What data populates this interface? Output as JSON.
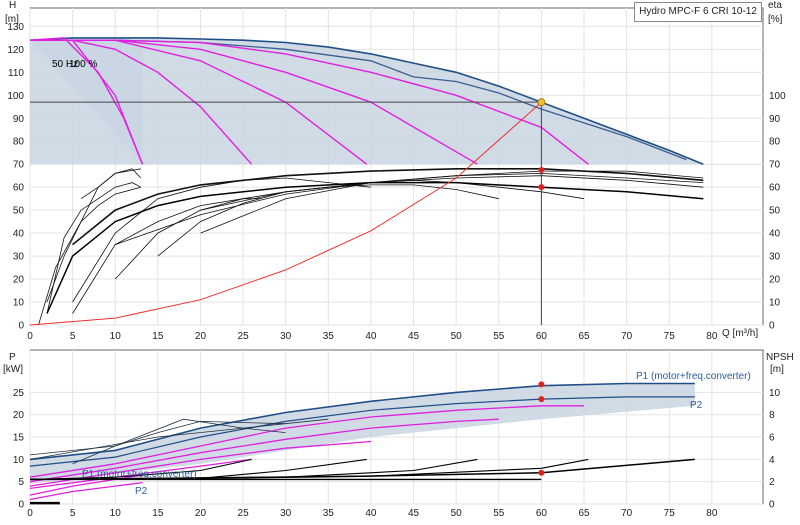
{
  "title": "Hydro MPC-F 6 CRI 10-12",
  "top_chart": {
    "ylabel_left": "H",
    "ylabel_left_unit": "[m]",
    "ylabel_right": "eta",
    "ylabel_right_unit": "[%]",
    "xlabel": "Q [m³/h]",
    "x_ticks": [
      0,
      5,
      10,
      15,
      20,
      25,
      30,
      35,
      40,
      45,
      50,
      55,
      60,
      65,
      70,
      75,
      80
    ],
    "y_left_ticks": [
      0,
      10,
      20,
      30,
      40,
      50,
      60,
      70,
      80,
      90,
      100,
      110,
      120,
      130
    ],
    "y_right_ticks": [
      0,
      10,
      20,
      30,
      40,
      50,
      60,
      70,
      80,
      90,
      100
    ],
    "annot_freq": "50 Hz",
    "annot_pct": "100 %",
    "duty_q": 60,
    "duty_h": 97
  },
  "bottom_chart": {
    "ylabel_left": "P",
    "ylabel_left_unit": "[kW]",
    "ylabel_right": "NPSH",
    "ylabel_right_unit": "[m]",
    "y_left_ticks": [
      0,
      5,
      10,
      15,
      20,
      25
    ],
    "y_right_ticks": [
      0,
      2,
      4,
      6,
      8,
      10
    ],
    "label_p1_top": "P1 (motor+freq.converter)",
    "label_p2_top": "P2",
    "label_p1_bottom": "P1 (motor+freq.converter)",
    "label_p2_bottom": "P2"
  },
  "chart_data": [
    {
      "type": "line",
      "title": "Hydro MPC-F 6 CRI 10-12",
      "xlabel": "Q [m³/h]",
      "ylabel": "H [m]",
      "y2label": "eta [%]",
      "xlim": [
        0,
        80
      ],
      "ylim": [
        0,
        130
      ],
      "y2lim": [
        0,
        100
      ],
      "grid": true,
      "series": [
        {
          "x": [
            0,
            5,
            10,
            15,
            20,
            25,
            30,
            35,
            40,
            45,
            50,
            55,
            60,
            65,
            70,
            75,
            79
          ],
          "y": [
            124,
            125,
            125,
            125,
            124.5,
            124,
            123,
            121,
            118,
            114,
            110,
            104,
            97,
            90,
            83,
            76,
            70
          ]
        },
        {
          "x": [
            0,
            5,
            10,
            13.2
          ],
          "y": [
            124,
            124,
            100,
            70
          ]
        },
        {
          "x": [
            0,
            5,
            10,
            15,
            20,
            26
          ],
          "y": [
            124,
            124,
            120,
            110,
            95,
            70
          ]
        },
        {
          "x": [
            0,
            10,
            20,
            30,
            39.5
          ],
          "y": [
            124,
            124,
            115,
            97,
            70
          ]
        },
        {
          "x": [
            0,
            10,
            20,
            30,
            40,
            52.5
          ],
          "y": [
            124,
            124,
            120,
            110,
            97,
            70
          ]
        },
        {
          "x": [
            0,
            10,
            20,
            30,
            40,
            50,
            60,
            65.5
          ],
          "y": [
            124,
            124,
            123,
            118,
            110,
            100,
            86,
            70
          ]
        },
        {
          "x": [
            2,
            5,
            10,
            15,
            20,
            30,
            40,
            50,
            60,
            70,
            79
          ],
          "y": [
            5,
            30,
            45,
            52,
            56,
            60,
            62,
            62,
            60,
            58,
            55
          ]
        },
        {
          "x": [
            0,
            10,
            20,
            30,
            40,
            50,
            60
          ],
          "y": [
            0,
            3,
            11,
            24,
            41,
            64,
            97
          ]
        }
      ]
    },
    {
      "type": "line",
      "xlabel": "Q [m³/h]",
      "ylabel": "P [kW]",
      "y2label": "NPSH [m]",
      "xlim": [
        0,
        80
      ],
      "ylim": [
        0,
        29
      ],
      "y2lim": [
        0,
        11.6
      ],
      "grid": true,
      "series": [
        {
          "name": "P1 (motor+freq.converter)",
          "x": [
            0,
            10,
            20,
            30,
            40,
            50,
            60,
            70,
            78
          ],
          "y": [
            10,
            12,
            17,
            20.5,
            23,
            25,
            26.5,
            27,
            27
          ]
        },
        {
          "name": "P2",
          "x": [
            0,
            10,
            20,
            30,
            40,
            50,
            60,
            70,
            78
          ],
          "y": [
            8.5,
            10.5,
            15,
            18.5,
            21,
            22.5,
            23.5,
            24,
            24
          ]
        },
        {
          "name": "P1 (motor+freq.converter)",
          "x": [
            0,
            5,
            13.2
          ],
          "y": [
            5.8,
            6.8,
            7.5
          ]
        },
        {
          "name": "P2",
          "x": [
            0,
            5,
            13.2
          ],
          "y": [
            2.5,
            3.5,
            4.2
          ]
        },
        {
          "x": [
            0,
            20,
            40,
            60,
            78
          ],
          "y": [
            2.2,
            2.3,
            2.5,
            2.8,
            4
          ]
        }
      ]
    }
  ]
}
